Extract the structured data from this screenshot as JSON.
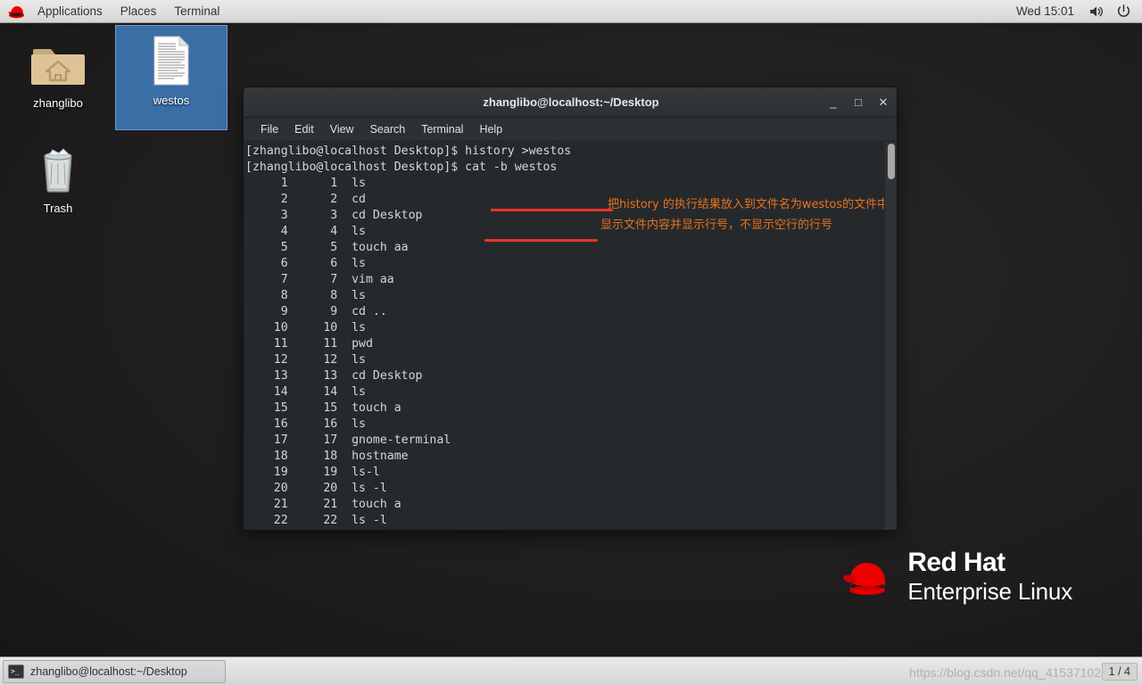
{
  "top_panel": {
    "logo_icon": "redhat-logo-icon",
    "menus": [
      "Applications",
      "Places",
      "Terminal"
    ],
    "clock": "Wed 15:01",
    "volume_icon": "volume-icon",
    "power_icon": "power-icon"
  },
  "desktop": {
    "icons": [
      {
        "label": "zhanglibo",
        "icon": "home-folder-icon",
        "selected": false
      },
      {
        "label": "westos",
        "icon": "text-document-icon",
        "selected": true
      },
      {
        "label": "Trash",
        "icon": "trash-icon",
        "selected": false
      }
    ]
  },
  "terminal": {
    "title": "zhanglibo@localhost:~/Desktop",
    "window_buttons": {
      "minimize": "_",
      "maximize": "□",
      "close": "✕"
    },
    "menubar": [
      "File",
      "Edit",
      "View",
      "Search",
      "Terminal",
      "Help"
    ],
    "prompt": "[zhanglibo@localhost Desktop]$",
    "commands": [
      {
        "prompt": "[zhanglibo@localhost Desktop]$",
        "command": " history >westos"
      },
      {
        "prompt": "[zhanglibo@localhost Desktop]$",
        "command": " cat -b westos"
      }
    ],
    "output_lines": [
      {
        "n": "1",
        "b": "1",
        "cmd": "ls"
      },
      {
        "n": "2",
        "b": "2",
        "cmd": "cd"
      },
      {
        "n": "3",
        "b": "3",
        "cmd": "cd Desktop"
      },
      {
        "n": "4",
        "b": "4",
        "cmd": "ls"
      },
      {
        "n": "5",
        "b": "5",
        "cmd": "touch aa"
      },
      {
        "n": "6",
        "b": "6",
        "cmd": "ls"
      },
      {
        "n": "7",
        "b": "7",
        "cmd": "vim aa"
      },
      {
        "n": "8",
        "b": "8",
        "cmd": "ls"
      },
      {
        "n": "9",
        "b": "9",
        "cmd": "cd .."
      },
      {
        "n": "10",
        "b": "10",
        "cmd": "ls"
      },
      {
        "n": "11",
        "b": "11",
        "cmd": "pwd"
      },
      {
        "n": "12",
        "b": "12",
        "cmd": "ls"
      },
      {
        "n": "13",
        "b": "13",
        "cmd": "cd Desktop"
      },
      {
        "n": "14",
        "b": "14",
        "cmd": "ls"
      },
      {
        "n": "15",
        "b": "15",
        "cmd": "touch a"
      },
      {
        "n": "16",
        "b": "16",
        "cmd": "ls"
      },
      {
        "n": "17",
        "b": "17",
        "cmd": "gnome-terminal"
      },
      {
        "n": "18",
        "b": "18",
        "cmd": "hostname"
      },
      {
        "n": "19",
        "b": "19",
        "cmd": "ls-l"
      },
      {
        "n": "20",
        "b": "20",
        "cmd": "ls -l"
      },
      {
        "n": "21",
        "b": "21",
        "cmd": "touch a"
      },
      {
        "n": "22",
        "b": "22",
        "cmd": "ls -l"
      }
    ],
    "annotations": [
      {
        "text": "把history 的执行结果放入到文件名为westos的文件中"
      },
      {
        "text": "显示文件内容并显示行号，不显示空行的行号"
      }
    ]
  },
  "branding": {
    "line1": "Red Hat",
    "line2": "Enterprise Linux",
    "logo_icon": "redhat-fedora-icon"
  },
  "taskbar": {
    "window_button_label": "zhanglibo@localhost:~/Desktop",
    "window_button_icon": "terminal-icon",
    "workspace": "1 / 4",
    "watermark": "https://blog.csdn.net/qq_41537102"
  },
  "colors": {
    "accent_red": "#e8332a",
    "annotation_orange": "#e8721c",
    "selection_blue": "#3a6ea5",
    "terminal_bg": "#26292c"
  }
}
